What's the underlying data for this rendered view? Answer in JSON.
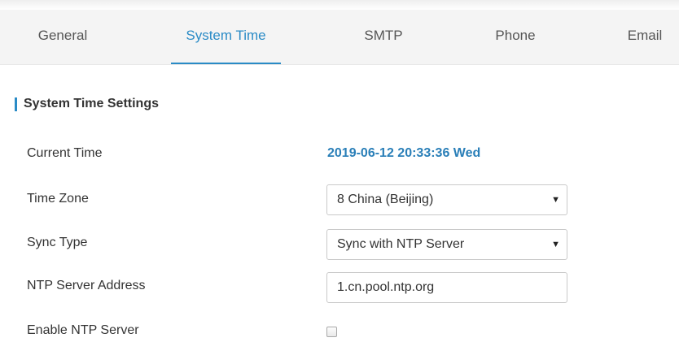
{
  "tabs": [
    {
      "label": "General",
      "active": false
    },
    {
      "label": "System Time",
      "active": true
    },
    {
      "label": "SMTP",
      "active": false
    },
    {
      "label": "Phone",
      "active": false
    },
    {
      "label": "Email",
      "active": false
    }
  ],
  "section": {
    "title": "System Time Settings"
  },
  "fields": {
    "current_time": {
      "label": "Current Time",
      "value": "2019-06-12 20:33:36 Wed"
    },
    "time_zone": {
      "label": "Time Zone",
      "value": "8 China (Beijing)",
      "caret_icon": "caret-down-icon"
    },
    "sync_type": {
      "label": "Sync Type",
      "value": "Sync with NTP Server",
      "caret_icon": "caret-down-icon"
    },
    "ntp_server": {
      "label": "NTP Server Address",
      "value": "1.cn.pool.ntp.org"
    },
    "enable_ntp": {
      "label": "Enable NTP Server",
      "checked": false
    }
  },
  "colors": {
    "accent": "#2a8bc6",
    "current_time_text": "#2a7fb8",
    "tabbar_background": "#f4f4f4",
    "text": "#333333"
  }
}
